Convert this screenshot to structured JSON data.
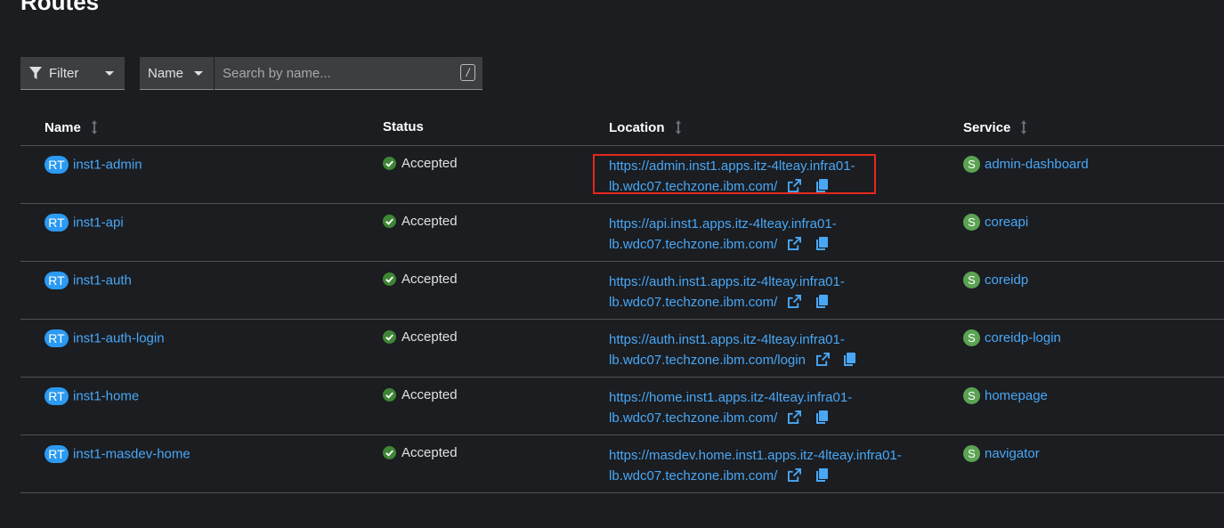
{
  "page": {
    "title": "Routes"
  },
  "toolbar": {
    "filter_label": "Filter",
    "name_label": "Name",
    "search_placeholder": "Search by name...",
    "search_value": "",
    "shortcut_hint": "/"
  },
  "table": {
    "columns": [
      "Name",
      "Status",
      "Location",
      "Service"
    ],
    "rows": [
      {
        "badge": "RT",
        "name": "inst1-admin",
        "status": "Accepted",
        "location_line1": "https://admin.inst1.apps.itz-4lteay.infra01-",
        "location_line2": "lb.wdc07.techzone.ibm.com/",
        "service_badge": "S",
        "service": "admin-dashboard"
      },
      {
        "badge": "RT",
        "name": "inst1-api",
        "status": "Accepted",
        "location_line1": "https://api.inst1.apps.itz-4lteay.infra01-",
        "location_line2": "lb.wdc07.techzone.ibm.com/",
        "service_badge": "S",
        "service": "coreapi"
      },
      {
        "badge": "RT",
        "name": "inst1-auth",
        "status": "Accepted",
        "location_line1": "https://auth.inst1.apps.itz-4lteay.infra01-",
        "location_line2": "lb.wdc07.techzone.ibm.com/",
        "service_badge": "S",
        "service": "coreidp"
      },
      {
        "badge": "RT",
        "name": "inst1-auth-login",
        "status": "Accepted",
        "location_line1": "https://auth.inst1.apps.itz-4lteay.infra01-",
        "location_line2": "lb.wdc07.techzone.ibm.com/login",
        "service_badge": "S",
        "service": "coreidp-login"
      },
      {
        "badge": "RT",
        "name": "inst1-home",
        "status": "Accepted",
        "location_line1": "https://home.inst1.apps.itz-4lteay.infra01-",
        "location_line2": "lb.wdc07.techzone.ibm.com/",
        "service_badge": "S",
        "service": "homepage"
      },
      {
        "badge": "RT",
        "name": "inst1-masdev-home",
        "status": "Accepted",
        "location_line1": "https://masdev.home.inst1.apps.itz-4lteay.infra01-",
        "location_line2": "lb.wdc07.techzone.ibm.com/",
        "service_badge": "S",
        "service": "navigator"
      }
    ]
  },
  "icons": {
    "filter": "filter-icon",
    "caret": "caret-down-icon",
    "sort": "sort-icon",
    "status_ok": "check-circle-icon",
    "external": "external-link-icon",
    "copy": "copy-icon"
  },
  "colors": {
    "background": "#1b1d21",
    "link": "#49a7f5",
    "route_badge": "#2b9af3",
    "service_badge": "#5ba352",
    "success": "#3e8635",
    "highlight": "#e5271d"
  }
}
